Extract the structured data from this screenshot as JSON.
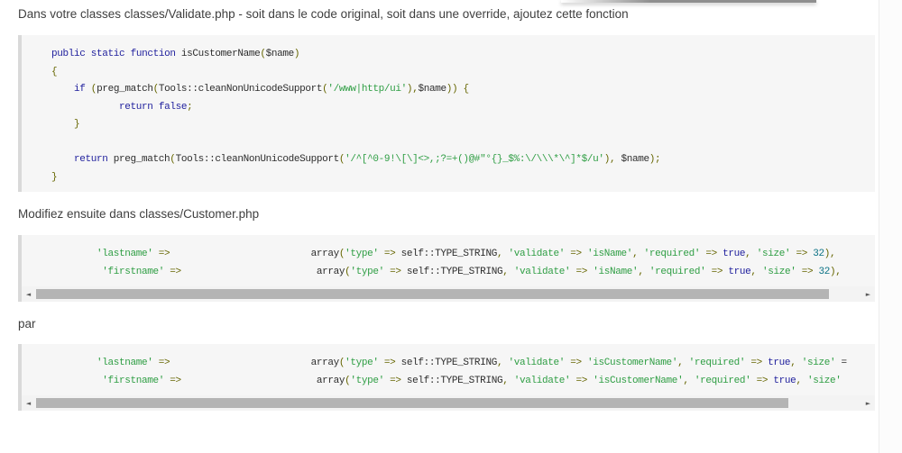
{
  "paragraphs": [
    "Dans votre classes classes/Validate.php - soit dans le code original, soit dans une override, ajoutez cette fonction",
    "Modifiez ensuite dans classes/Customer.php",
    "par"
  ],
  "code_blocks": [
    {
      "name": "validate-php-function",
      "has_hscrollbar": false,
      "lines": [
        "    public static function isCustomerName($name)",
        "    {",
        "        if (preg_match(Tools::cleanNonUnicodeSupport('/www|http/ui'),$name)) {",
        "                return false;",
        "        }",
        "",
        "        return preg_match(Tools::cleanNonUnicodeSupport('/^[^0-9!\\[\\]<>,;?=+()@#\"°{}_$%:\\/\\\\\\*\\^]*$/u'), $name);",
        "    }"
      ]
    },
    {
      "name": "customer-php-before",
      "has_hscrollbar": true,
      "thumb_percent": 96,
      "lines": [
        "            'lastname' =>                         array('type' => self::TYPE_STRING, 'validate' => 'isName', 'required' => true, 'size' => 32),",
        "             'firstname' =>                        array('type' => self::TYPE_STRING, 'validate' => 'isName', 'required' => true, 'size' => 32),"
      ]
    },
    {
      "name": "customer-php-after",
      "has_hscrollbar": true,
      "thumb_percent": 91,
      "lines": [
        "            'lastname' =>                         array('type' => self::TYPE_STRING, 'validate' => 'isCustomerName', 'required' => true, 'size' =",
        "             'firstname' =>                        array('type' => self::TYPE_STRING, 'validate' => 'isCustomerName', 'required' => true, 'size'"
      ]
    }
  ],
  "scrollbar": {
    "arrow_left_glyph": "◄",
    "arrow_right_glyph": "►"
  },
  "colors": {
    "paragraph_text": "#3f3f3f",
    "code_background": "#f6f6f6",
    "code_left_border": "#d9d9d9",
    "plain": "#2d2d2d",
    "keyword": "#22229e",
    "string": "#2f9e44",
    "number": "#0b7285",
    "punctuation": "#666600",
    "scrollbar_thumb": "#b4b4b4",
    "scrollbar_track": "#f3f3f3"
  }
}
